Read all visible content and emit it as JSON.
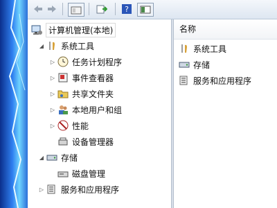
{
  "tree": {
    "root": "计算机管理(本地)",
    "system_tools": "系统工具",
    "task_scheduler": "任务计划程序",
    "event_viewer": "事件查看器",
    "shared_folders": "共享文件夹",
    "local_users_groups": "本地用户和组",
    "performance": "性能",
    "device_manager": "设备管理器",
    "storage": "存储",
    "disk_management": "磁盘管理",
    "services_apps": "服务和应用程序"
  },
  "list": {
    "column_name": "名称",
    "items": [
      "系统工具",
      "存储",
      "服务和应用程序"
    ]
  },
  "icons": [
    "back-arrow-icon",
    "forward-arrow-icon",
    "up-folder-icon",
    "export-list-icon",
    "help-icon",
    "console-tree-toggle-icon"
  ]
}
